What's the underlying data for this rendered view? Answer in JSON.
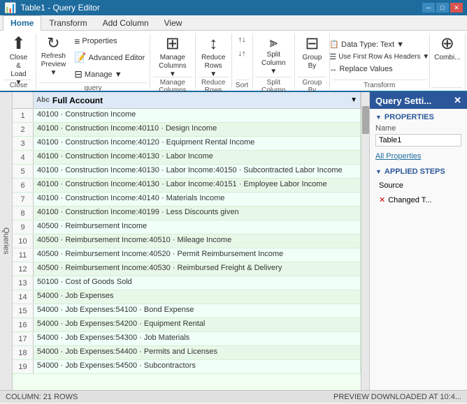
{
  "titleBar": {
    "title": "Table1 - Query Editor",
    "controls": [
      "─",
      "□",
      "✕"
    ]
  },
  "ribbonTabs": {
    "tabs": [
      "Home",
      "Transform",
      "Add Column",
      "View"
    ],
    "activeTab": "Home"
  },
  "ribbon": {
    "groups": [
      {
        "name": "close",
        "label": "Close",
        "buttons": [
          {
            "id": "close-load",
            "icon": "⬆",
            "label": "Close &\nLoad ▼",
            "size": "large"
          }
        ]
      },
      {
        "name": "query",
        "label": "Query",
        "buttons": [
          {
            "id": "refresh-preview",
            "icon": "↻",
            "label": "Refresh\nPreview ▼",
            "size": "large"
          },
          {
            "id": "properties",
            "icon": "≡",
            "label": "Properties",
            "size": "small"
          },
          {
            "id": "advanced-editor",
            "icon": "📝",
            "label": "Advanced Editor",
            "size": "small"
          },
          {
            "id": "manage",
            "icon": "▾",
            "label": "Manage ▼",
            "size": "small"
          }
        ]
      },
      {
        "name": "manage-columns",
        "label": "Manage\nColumns",
        "buttons": [
          {
            "id": "manage-columns-btn",
            "icon": "⊞",
            "label": "Manage\nColumns ▼",
            "size": "large"
          }
        ]
      },
      {
        "name": "reduce-rows",
        "label": "Reduce\nRows",
        "buttons": [
          {
            "id": "reduce-rows-btn",
            "icon": "↕",
            "label": "Reduce\nRows ▼",
            "size": "large"
          }
        ]
      },
      {
        "name": "sort",
        "label": "Sort",
        "buttons": [
          {
            "id": "sort-asc",
            "icon": "↑",
            "label": "",
            "size": "small"
          },
          {
            "id": "sort-desc",
            "icon": "↓",
            "label": "",
            "size": "small"
          }
        ]
      },
      {
        "name": "split-column",
        "label": "Split\nColumn",
        "buttons": [
          {
            "id": "split-column-btn",
            "icon": "⫸",
            "label": "Split\nColumn ▼",
            "size": "large"
          }
        ]
      },
      {
        "name": "group-by",
        "label": "Group\nBy",
        "buttons": [
          {
            "id": "group-by-btn",
            "icon": "⊟",
            "label": "Group\nBy",
            "size": "large"
          }
        ]
      },
      {
        "name": "transform",
        "label": "Transform",
        "buttons": [
          {
            "id": "data-type",
            "label": "Data Type: Text ▼",
            "size": "dropdown"
          },
          {
            "id": "first-row-headers",
            "label": "Use First Row As Headers ▼",
            "size": "dropdown"
          },
          {
            "id": "replace-values",
            "label": "↔ Replace Values",
            "size": "dropdown"
          }
        ]
      },
      {
        "name": "combi",
        "label": "",
        "buttons": [
          {
            "id": "combi-btn",
            "icon": "⊕",
            "label": "Combi...",
            "size": "large"
          }
        ]
      }
    ]
  },
  "grid": {
    "column": {
      "icon": "Abc",
      "name": "Full Account"
    },
    "rows": [
      {
        "num": 1,
        "value": "40100 · Construction Income"
      },
      {
        "num": 2,
        "value": "40100 · Construction Income:40110 · Design Income"
      },
      {
        "num": 3,
        "value": "40100 · Construction Income:40120 · Equipment Rental Income"
      },
      {
        "num": 4,
        "value": "40100 · Construction Income:40130 · Labor Income"
      },
      {
        "num": 5,
        "value": "40100 · Construction Income:40130 · Labor Income:40150 · Subcontracted Labor Income"
      },
      {
        "num": 6,
        "value": "40100 · Construction Income:40130 · Labor Income:40151 · Employee Labor Income"
      },
      {
        "num": 7,
        "value": "40100 · Construction Income:40140 · Materials Income"
      },
      {
        "num": 8,
        "value": "40100 · Construction Income:40199 · Less Discounts given"
      },
      {
        "num": 9,
        "value": "40500 · Reimbursement Income"
      },
      {
        "num": 10,
        "value": "40500 · Reimbursement Income:40510 · Mileage Income"
      },
      {
        "num": 11,
        "value": "40500 · Reimbursement Income:40520 · Permit Reimbursement Income"
      },
      {
        "num": 12,
        "value": "40500 · Reimbursement Income:40530 · Reimbursed Freight & Delivery"
      },
      {
        "num": 13,
        "value": "50100 · Cost of Goods Sold"
      },
      {
        "num": 14,
        "value": "54000 · Job Expenses"
      },
      {
        "num": 15,
        "value": "54000 · Job Expenses:54100 · Bond Expense"
      },
      {
        "num": 16,
        "value": "54000 · Job Expenses:54200 · Equipment Rental"
      },
      {
        "num": 17,
        "value": "54000 · Job Expenses:54300 · Job Materials"
      },
      {
        "num": 18,
        "value": "54000 · Job Expenses:54400 · Permits and Licenses"
      },
      {
        "num": 19,
        "value": "54000 · Job Expenses:54500 · Subcontractors"
      }
    ]
  },
  "querySettings": {
    "panelTitle": "Query Setti...",
    "propertiesSection": "PROPERTIES",
    "nameLabel": "Name",
    "nameValue": "Table1",
    "allPropertiesLink": "All Properties",
    "appliedStepsSection": "APPLIED STEPS",
    "steps": [
      {
        "id": "source",
        "label": "Source",
        "hasX": false
      },
      {
        "id": "changed-t",
        "label": "Changed T...",
        "hasX": true
      }
    ]
  },
  "statusBar": {
    "leftText": "COLUMN: 21 ROWS",
    "rightText": "PREVIEW DOWNLOADED AT 10:4..."
  },
  "sidebar": {
    "label": "Queries"
  }
}
